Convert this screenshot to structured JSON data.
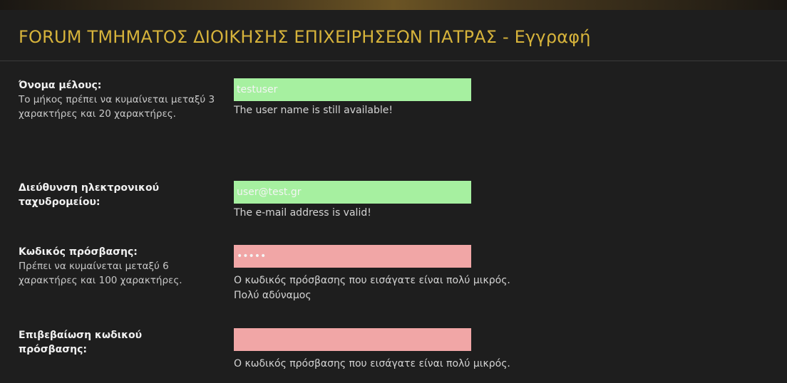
{
  "page": {
    "title": "FORUM ΤΜΗΜΑΤΟΣ ΔΙΟΙΚΗΣΗΣ ΕΠΙΧΕΙΡΗΣΕΩΝ ΠΑΤΡΑΣ - Εγγραφή"
  },
  "form": {
    "username": {
      "label": "Όνομα μέλους:",
      "description": "Το μήκος πρέπει να κυμαίνεται μεταξύ 3 χαρακτήρες και 20 χαρακτήρες.",
      "value": "testuser",
      "message": "The user name is still available!"
    },
    "email": {
      "label": "Διεύθυνση ηλεκτρονικού ταχυδρομείου:",
      "value": "user@test.gr",
      "message": "The e-mail address is valid!"
    },
    "password": {
      "label": "Κωδικός πρόσβασης:",
      "description": "Πρέπει να κυμαίνεται μεταξύ 6 χαρακτήρες και 100 χαρακτήρες.",
      "value": "•••••",
      "message_line1": "Ο κωδικός πρόσβασης που εισάγατε είναι πολύ μικρός.",
      "message_line2": "Πολύ αδύναμος"
    },
    "confirm_password": {
      "label": "Επιβεβαίωση κωδικού πρόσβασης:",
      "value": "",
      "message": "Ο κωδικός πρόσβασης που εισάγατε είναι πολύ μικρός."
    }
  },
  "colors": {
    "title": "#d6b33b",
    "valid_field": "#a6f0a0",
    "invalid_field": "#f1a6a6",
    "background": "#1e1e1e"
  }
}
